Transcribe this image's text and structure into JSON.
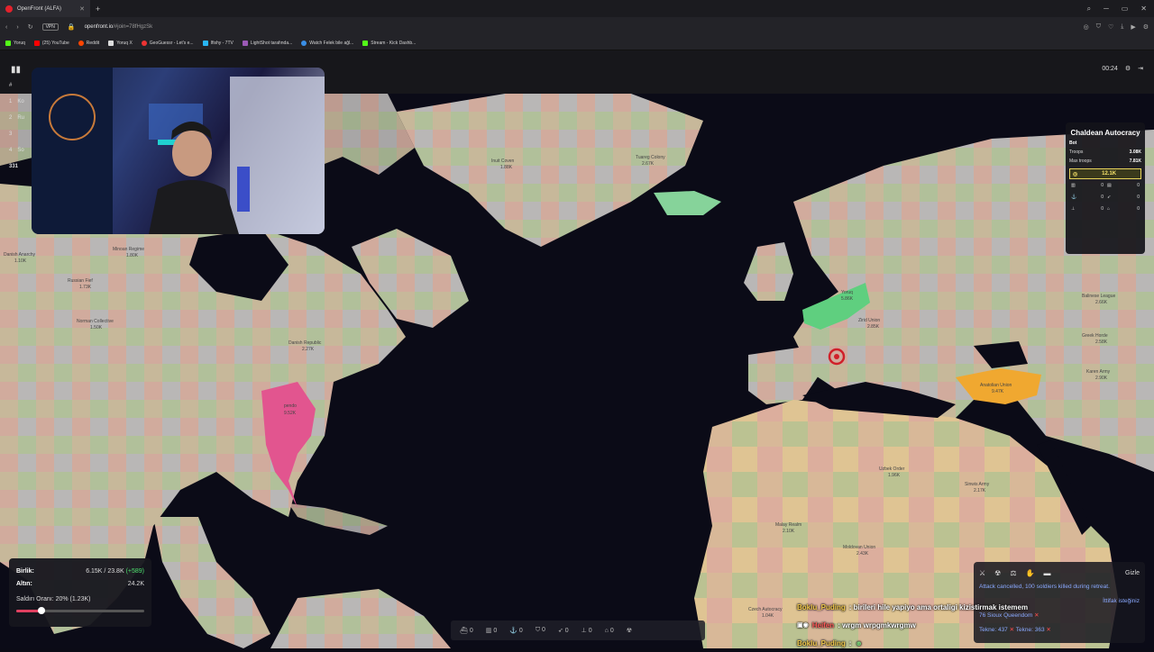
{
  "browser": {
    "tab_title": "OpenFront (ALFA)",
    "url_domain": "openfront.io",
    "url_path": "/#join=78fHgzSk",
    "vpn_label": "VPN",
    "bookmarks": [
      "Yoruq",
      "(25) YouTube",
      "Reddit",
      "Yoruq X",
      "GeoGuessr - Let's e...",
      "Ifishy - 7TV",
      "LightShot tarafında...",
      "Watch Felek bile ağl...",
      "Stream - Kick Dashb..."
    ]
  },
  "game": {
    "timer": "00:24",
    "leaderboard": {
      "header": "#",
      "ranks": [
        "1",
        "2",
        "3",
        "4"
      ],
      "names": [
        "Ko",
        "Ru",
        "",
        "So"
      ],
      "player_rank": "331"
    },
    "player_panel": {
      "name": "Chaldean Autocracy",
      "type": "Bot",
      "troops_label": "Troops",
      "troops_value": "3.08K",
      "max_troops_label": "Max troops",
      "max_troops_value": "7.81K",
      "gold_value": "12.1K",
      "counts": [
        "0",
        "0",
        "0",
        "0",
        "0",
        "0"
      ]
    },
    "stats": {
      "units_label": "Birlik:",
      "units_value": "6.15K / 23.8K",
      "units_delta": "(+589)",
      "gold_label": "Altın:",
      "gold_value": "24.2K",
      "attack_ratio_label": "Saldırı Oranı: 20% (1.23K)",
      "attack_ratio_fraction": 0.2
    },
    "build_bar_counts": [
      "0",
      "0",
      "0",
      "0",
      "0",
      "0",
      "0"
    ],
    "events": {
      "hide_label": "Gizle",
      "items": [
        {
          "text": "Attack cancelled, 100 soldiers killed during retreat.",
          "cross": ""
        },
        {
          "text": "İttifak isteğiniz",
          "cross": ""
        },
        {
          "text": "76 Sioux Queendom",
          "cross": "✕"
        },
        {
          "text": "Tekne: 437",
          "cross": "✕"
        },
        {
          "text": "Tekne: 363",
          "cross": "✕"
        }
      ]
    },
    "chat": [
      {
        "user": "Boklu_Puding",
        "msg": ": birileri hile yapiyo ama ortaligi kizistirmak istemem"
      },
      {
        "user": "Heifen",
        "msg": ": wrgm wrpgmkwrgmw"
      },
      {
        "user": "Boklu_Puding",
        "msg": ":"
      }
    ],
    "map_labels": [
      {
        "name": "Yoruq",
        "value": "5.86K"
      },
      {
        "name": "pendo",
        "value": "9.52K"
      },
      {
        "name": "Anatolian Union",
        "value": "9.47K"
      },
      {
        "name": "Russian Fief",
        "value": "1.73K"
      },
      {
        "name": "Minoan Regime",
        "value": "1.80K"
      },
      {
        "name": "Danish Anarchy",
        "value": "1.10K"
      },
      {
        "name": "Danish Republic",
        "value": "2.27K"
      },
      {
        "name": "Greek Horde",
        "value": "2.58K"
      },
      {
        "name": "Karen Army",
        "value": "2.90K"
      },
      {
        "name": "Zirid Union",
        "value": "2.85K"
      },
      {
        "name": "Uzbek Order",
        "value": "1.96K"
      },
      {
        "name": "Sinwis Army",
        "value": "2.17K"
      },
      {
        "name": "Malay Realm",
        "value": "2.10K"
      },
      {
        "name": "Moldovan Union",
        "value": "2.43K"
      },
      {
        "name": "Czech Autocracy",
        "value": "1.04K"
      },
      {
        "name": "Inuit Coven",
        "value": "1.88K"
      },
      {
        "name": "Tuareg Colony",
        "value": "2.67K"
      },
      {
        "name": "Norman Collective",
        "value": "1.50K"
      },
      {
        "name": "Balinese League",
        "value": "2.66K"
      }
    ]
  }
}
